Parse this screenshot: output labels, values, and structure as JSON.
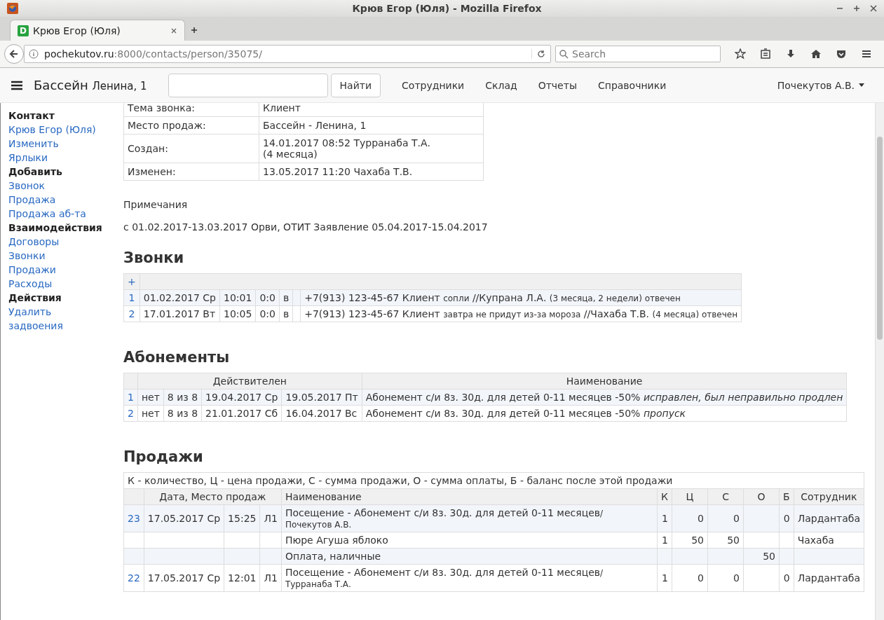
{
  "window": {
    "title": "Крюв Егор (Юля) - Mozilla Firefox"
  },
  "tab": {
    "label": "Крюв Егор (Юля)",
    "favicon": "D"
  },
  "address": {
    "host": "pochekutov.ru",
    "path": ":8000/contacts/person/35075/"
  },
  "search": {
    "placeholder": "Search"
  },
  "navbar": {
    "brand": "Бассейн",
    "brand_sub": "Ленина, 1",
    "search_button": "Найти",
    "links": [
      "Сотрудники",
      "Склад",
      "Отчеты",
      "Справочники"
    ],
    "user": "Почекутов А.В."
  },
  "sidebar": [
    {
      "kind": "heading",
      "label": "Контакт"
    },
    {
      "kind": "link",
      "label": "Крюв Егор (Юля)"
    },
    {
      "kind": "link",
      "label": "Изменить"
    },
    {
      "kind": "link",
      "label": "Ярлыки"
    },
    {
      "kind": "heading",
      "label": "Добавить"
    },
    {
      "kind": "link",
      "label": "Звонок"
    },
    {
      "kind": "link",
      "label": "Продажа"
    },
    {
      "kind": "link",
      "label": "Продажа аб-та"
    },
    {
      "kind": "heading",
      "label": "Взаимодействия"
    },
    {
      "kind": "link",
      "label": "Договоры"
    },
    {
      "kind": "link",
      "label": "Звонки"
    },
    {
      "kind": "link",
      "label": "Продажи"
    },
    {
      "kind": "link",
      "label": "Расходы"
    },
    {
      "kind": "heading",
      "label": "Действия"
    },
    {
      "kind": "link",
      "label": "Удалить"
    },
    {
      "kind": "link",
      "label": "задвоения"
    }
  ],
  "info": [
    {
      "label": "Тема звонка:",
      "value": [
        "Клиент"
      ]
    },
    {
      "label": "Место продаж:",
      "value": [
        "Бассейн - Ленина, 1"
      ]
    },
    {
      "label": "Создан:",
      "value": [
        "14.01.2017 08:52 Турранаба Т.А.",
        "(4 месяца)"
      ]
    },
    {
      "label": "Изменен:",
      "value": [
        "13.05.2017 11:20 Чахаба Т.В."
      ]
    }
  ],
  "notes": {
    "title": "Примечания",
    "text": "с 01.02.2017-13.03.2017 Орви, ОТИТ Заявление 05.04.2017-15.04.2017"
  },
  "calls": {
    "title": "Звонки",
    "add": "+",
    "rows": [
      {
        "num": "1",
        "date": "01.02.2017 Ср",
        "time": "10:01",
        "duration": "0:0",
        "direction": "в",
        "phone": "+7(913) 123-45-67 Клиент",
        "note": "сопли",
        "author": "//Купрана Л.А.",
        "status": "(3 месяца, 2 недели) отвечен"
      },
      {
        "num": "2",
        "date": "17.01.2017 Вт",
        "time": "10:05",
        "duration": "0:0",
        "direction": "в",
        "phone": "+7(913) 123-45-67 Клиент",
        "note": "завтра не придут из-за мороза",
        "author": "//Чахаба Т.В.",
        "status": "(4 месяца) отвечен"
      }
    ]
  },
  "subscriptions": {
    "title": "Абонементы",
    "columns": [
      "Действителен",
      "Наименование"
    ],
    "rows": [
      {
        "num": "1",
        "active": "нет",
        "visits": "8 из 8",
        "from": "19.04.2017 Ср",
        "to": "19.05.2017 Пт",
        "name": "Абонемент с/и 8з. 30д. для детей 0-11 месяцев -50%",
        "note": "исправлен, был неправильно продлен"
      },
      {
        "num": "2",
        "active": "нет",
        "visits": "8 из 8",
        "from": "21.01.2017 Сб",
        "to": "16.04.2017 Вс",
        "name": "Абонемент с/и 8з. 30д. для детей 0-11 месяцев -50%",
        "note": "пропуск"
      }
    ]
  },
  "sales": {
    "title": "Продажи",
    "legend": "К - количество, Ц - цена продажи, С - сумма продажи, О - сумма оплаты, Б - баланс после этой продажи",
    "columns": [
      "Дата, Место продаж",
      "Наименование",
      "К",
      "Ц",
      "С",
      "О",
      "Б",
      "Сотрудник"
    ],
    "rows": [
      {
        "num": "23",
        "date": "17.05.2017 Ср",
        "time": "15:25",
        "place": "Л1",
        "name": "Посещение - Абонемент с/и 8з. 30д. для детей 0-11 месяцев",
        "author": "/Почекутов А.В.",
        "k": "1",
        "c": "0",
        "s": "0",
        "b": "0",
        "employee": "Лардантаба"
      },
      {
        "name": "Пюре Агуша яблоко",
        "k": "1",
        "c": "50",
        "s": "50",
        "employee": "Чахаба"
      },
      {
        "name": "Оплата, наличные",
        "o": "50"
      },
      {
        "num": "22",
        "date": "17.05.2017 Ср",
        "time": "12:01",
        "place": "Л1",
        "name": "Посещение - Абонемент с/и 8з. 30д. для детей 0-11 месяцев",
        "author": "/Турранаба Т.А.",
        "k": "1",
        "c": "0",
        "s": "0",
        "b": "0",
        "employee": "Лардантаба"
      }
    ]
  }
}
